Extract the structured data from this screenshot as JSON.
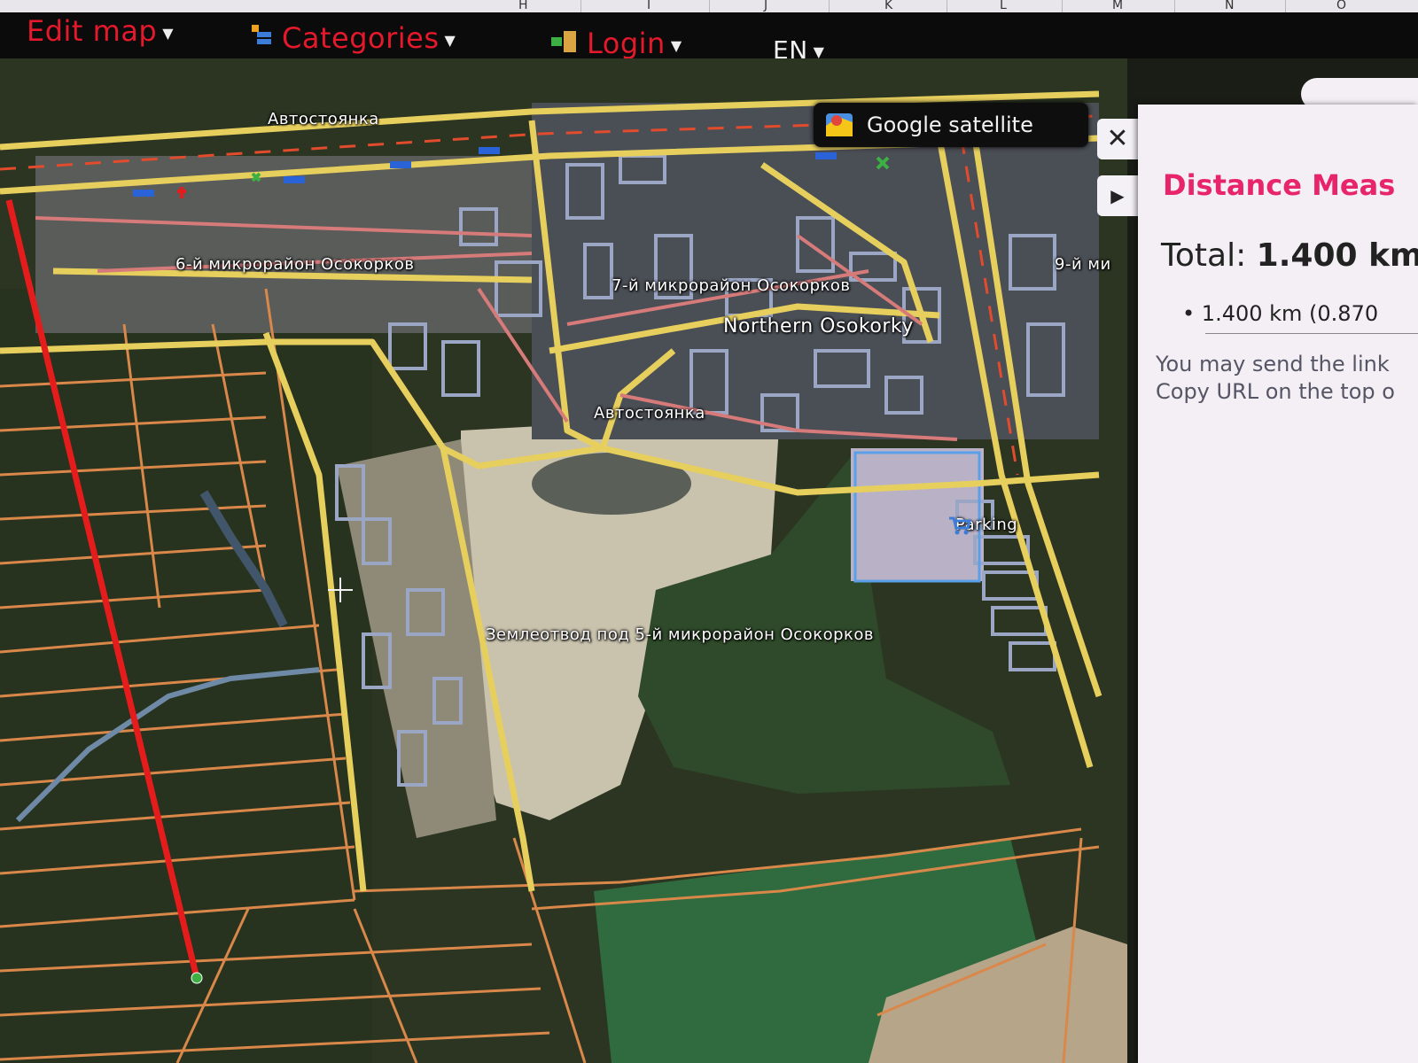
{
  "spreadsheet_columns": [
    "H",
    "I",
    "J",
    "K",
    "L",
    "M",
    "N",
    "O"
  ],
  "menu": {
    "edit_map": "Edit map",
    "categories": "Categories",
    "login": "Login",
    "language": "EN"
  },
  "map": {
    "layer_button": "Google satellite",
    "labels": {
      "parking_lot_top": "Автостоянка",
      "district_6": "6-й микрорайон Осокорков",
      "district_7": "7-й микрорайон Осокорков",
      "northern_osokorky": "Northern Osokorky",
      "district_9": "9-й ми",
      "parking_lot_mid": "Автостоянка",
      "parking": "Parking",
      "land_allotment": "Землеотвод под 5-й микрорайон Осокорков"
    },
    "colors": {
      "road_major": "#e7cf5e",
      "road_minor": "#d9884a",
      "measure_line": "#e41c1c",
      "building_outline": "#9aa6c4",
      "panel_title": "#e8246a"
    }
  },
  "panel": {
    "title": "Distance Meas",
    "total_label": "Total:",
    "total_value": "1.400 km",
    "segment": "1.400 km (0.870",
    "note_line1": "You may send the link",
    "note_line2": "Copy URL on the top o"
  },
  "icons": [
    "close-icon",
    "play-icon",
    "pencil-icon",
    "layers-icon",
    "login-icon",
    "google-maps-icon",
    "shopping-cart-icon",
    "crosshair-icon"
  ]
}
